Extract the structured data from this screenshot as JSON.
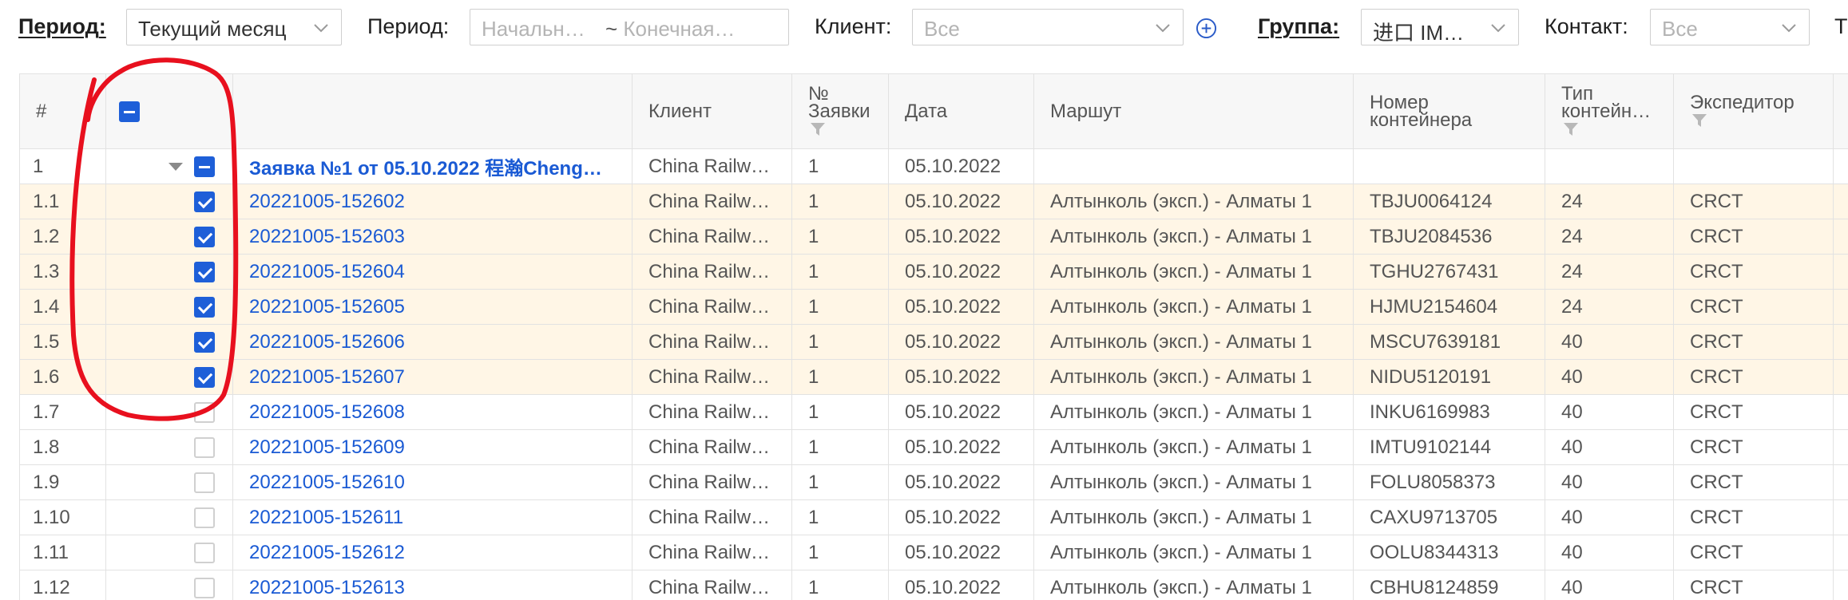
{
  "filters": {
    "period1": {
      "label": "Период",
      "colon": ":",
      "value": "Текущий месяц"
    },
    "period2": {
      "label": "Период",
      "colon": ":",
      "start_placeholder": "Начальн…",
      "separator": "~",
      "end_placeholder": "Конечная…"
    },
    "client": {
      "label": "Клиент",
      "colon": ":",
      "placeholder": "Все"
    },
    "group": {
      "label": "Группа",
      "colon": ":",
      "value": "进口 IM…"
    },
    "contact": {
      "label": "Контакт",
      "colon": ":",
      "placeholder": "Все"
    },
    "cut_label": "Т"
  },
  "grid": {
    "columns": {
      "num": "#",
      "client": "Клиент",
      "order_no": "№ Заявки",
      "date": "Дата",
      "route": "Маршут",
      "container_no": "Номер контейнера",
      "container_type": "Тип контейнера",
      "forwarder": "Экспедитор"
    },
    "group_row": {
      "num": "1",
      "title": "Заявка №1 от 05.10.2022 程瀚Cheng…",
      "client": "China Railw…",
      "order_no": "1",
      "date": "05.10.2022"
    },
    "rows": [
      {
        "num": "1.1",
        "checked": true,
        "id": "20221005-152602",
        "client": "China Railw…",
        "order_no": "1",
        "date": "05.10.2022",
        "route": "Алтынколь (эксп.) - Алматы 1",
        "container": "TBJU0064124",
        "type": "24",
        "forwarder": "CRCT"
      },
      {
        "num": "1.2",
        "checked": true,
        "id": "20221005-152603",
        "client": "China Railw…",
        "order_no": "1",
        "date": "05.10.2022",
        "route": "Алтынколь (эксп.) - Алматы 1",
        "container": "TBJU2084536",
        "type": "24",
        "forwarder": "CRCT"
      },
      {
        "num": "1.3",
        "checked": true,
        "id": "20221005-152604",
        "client": "China Railw…",
        "order_no": "1",
        "date": "05.10.2022",
        "route": "Алтынколь (эксп.) - Алматы 1",
        "container": "TGHU2767431",
        "type": "24",
        "forwarder": "CRCT"
      },
      {
        "num": "1.4",
        "checked": true,
        "id": "20221005-152605",
        "client": "China Railw…",
        "order_no": "1",
        "date": "05.10.2022",
        "route": "Алтынколь (эксп.) - Алматы 1",
        "container": "HJMU2154604",
        "type": "24",
        "forwarder": "CRCT"
      },
      {
        "num": "1.5",
        "checked": true,
        "id": "20221005-152606",
        "client": "China Railw…",
        "order_no": "1",
        "date": "05.10.2022",
        "route": "Алтынколь (эксп.) - Алматы 1",
        "container": "MSCU7639181",
        "type": "40",
        "forwarder": "CRCT"
      },
      {
        "num": "1.6",
        "checked": true,
        "id": "20221005-152607",
        "client": "China Railw…",
        "order_no": "1",
        "date": "05.10.2022",
        "route": "Алтынколь (эксп.) - Алматы 1",
        "container": "NIDU5120191",
        "type": "40",
        "forwarder": "CRCT"
      },
      {
        "num": "1.7",
        "checked": false,
        "id": "20221005-152608",
        "client": "China Railw…",
        "order_no": "1",
        "date": "05.10.2022",
        "route": "Алтынколь (эксп.) - Алматы 1",
        "container": "INKU6169983",
        "type": "40",
        "forwarder": "CRCT"
      },
      {
        "num": "1.8",
        "checked": false,
        "id": "20221005-152609",
        "client": "China Railw…",
        "order_no": "1",
        "date": "05.10.2022",
        "route": "Алтынколь (эксп.) - Алматы 1",
        "container": "IMTU9102144",
        "type": "40",
        "forwarder": "CRCT"
      },
      {
        "num": "1.9",
        "checked": false,
        "id": "20221005-152610",
        "client": "China Railw…",
        "order_no": "1",
        "date": "05.10.2022",
        "route": "Алтынколь (эксп.) - Алматы 1",
        "container": "FOLU8058373",
        "type": "40",
        "forwarder": "CRCT"
      },
      {
        "num": "1.10",
        "checked": false,
        "id": "20221005-152611",
        "client": "China Railw…",
        "order_no": "1",
        "date": "05.10.2022",
        "route": "Алтынколь (эксп.) - Алматы 1",
        "container": "CAXU9713705",
        "type": "40",
        "forwarder": "CRCT"
      },
      {
        "num": "1.11",
        "checked": false,
        "id": "20221005-152612",
        "client": "China Railw…",
        "order_no": "1",
        "date": "05.10.2022",
        "route": "Алтынколь (эксп.) - Алматы 1",
        "container": "OOLU8344313",
        "type": "40",
        "forwarder": "CRCT"
      },
      {
        "num": "1.12",
        "checked": false,
        "id": "20221005-152613",
        "client": "China Railw…",
        "order_no": "1",
        "date": "05.10.2022",
        "route": "Алтынколь (эксп.) - Алматы 1",
        "container": "CBHU8124859",
        "type": "40",
        "forwarder": "CRCT"
      }
    ]
  },
  "colors": {
    "accent": "#1e5fd8",
    "link": "#1a5ad4",
    "selected_row": "#fff6e6",
    "annotation": "#e8101e"
  },
  "icons": [
    "chevron-down-icon",
    "plus-circle-icon",
    "funnel-icon",
    "expand-triangle-icon",
    "checkbox-icon"
  ]
}
